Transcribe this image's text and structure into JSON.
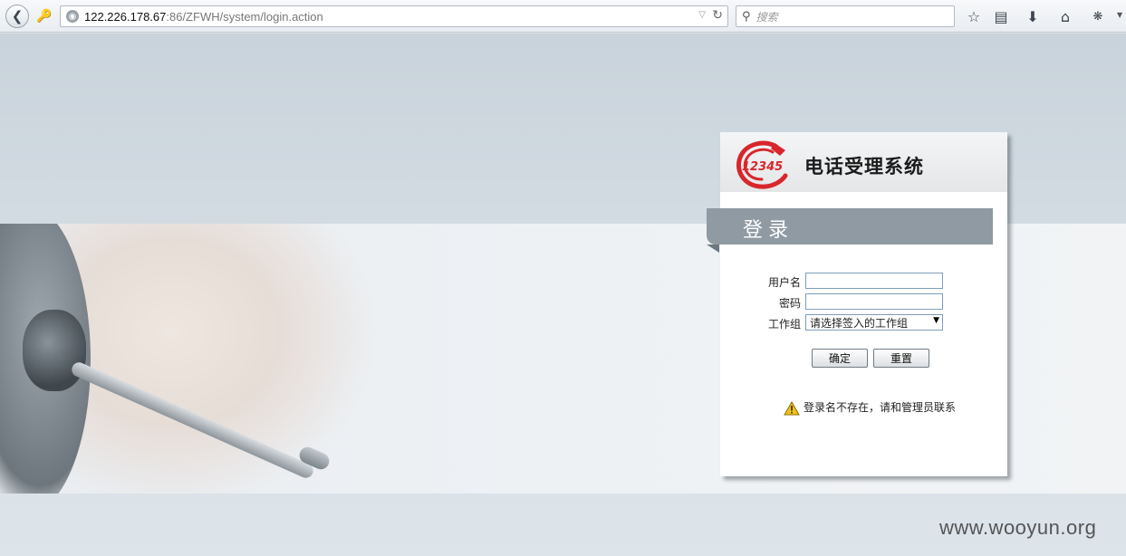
{
  "browser": {
    "url_host": "122.226.178.67",
    "url_path": ":86/ZFWH/system/login.action",
    "search_placeholder": "搜索",
    "icons": [
      "back-arrow-icon",
      "key-icon",
      "globe-icon",
      "dropdown-icon",
      "reload-icon",
      "search-icon",
      "bookmark-star-icon",
      "reading-list-icon",
      "download-icon",
      "home-icon",
      "addon-bug-icon"
    ]
  },
  "login": {
    "logo_number": "12345",
    "system_title": "电话受理系统",
    "heading": "登录",
    "username_label": "用户名",
    "username_value": "",
    "password_label": "密码",
    "password_value": "",
    "group_label": "工作组",
    "group_selected": "请选择签入的工作组",
    "confirm_label": "确定",
    "reset_label": "重置",
    "error_message": "登录名不存在，请和管理员联系",
    "colors": {
      "logo_red": "#d8262c",
      "heading_bar": "#8f9aa3"
    }
  },
  "watermark": "www.wooyun.org"
}
